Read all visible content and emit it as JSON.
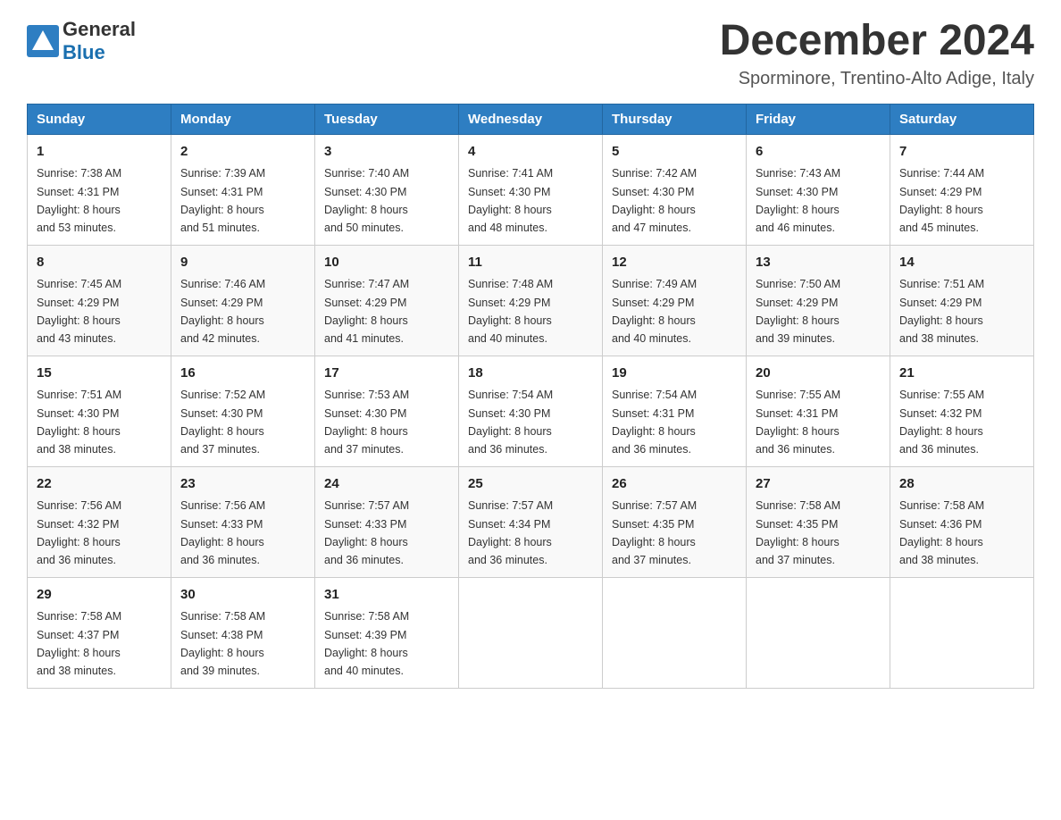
{
  "header": {
    "logo_general": "General",
    "logo_blue": "Blue",
    "month_title": "December 2024",
    "subtitle": "Sporminore, Trentino-Alto Adige, Italy"
  },
  "days_of_week": [
    "Sunday",
    "Monday",
    "Tuesday",
    "Wednesday",
    "Thursday",
    "Friday",
    "Saturday"
  ],
  "weeks": [
    [
      {
        "day": "1",
        "sunrise": "7:38 AM",
        "sunset": "4:31 PM",
        "daylight": "8 hours and 53 minutes."
      },
      {
        "day": "2",
        "sunrise": "7:39 AM",
        "sunset": "4:31 PM",
        "daylight": "8 hours and 51 minutes."
      },
      {
        "day": "3",
        "sunrise": "7:40 AM",
        "sunset": "4:30 PM",
        "daylight": "8 hours and 50 minutes."
      },
      {
        "day": "4",
        "sunrise": "7:41 AM",
        "sunset": "4:30 PM",
        "daylight": "8 hours and 48 minutes."
      },
      {
        "day": "5",
        "sunrise": "7:42 AM",
        "sunset": "4:30 PM",
        "daylight": "8 hours and 47 minutes."
      },
      {
        "day": "6",
        "sunrise": "7:43 AM",
        "sunset": "4:30 PM",
        "daylight": "8 hours and 46 minutes."
      },
      {
        "day": "7",
        "sunrise": "7:44 AM",
        "sunset": "4:29 PM",
        "daylight": "8 hours and 45 minutes."
      }
    ],
    [
      {
        "day": "8",
        "sunrise": "7:45 AM",
        "sunset": "4:29 PM",
        "daylight": "8 hours and 43 minutes."
      },
      {
        "day": "9",
        "sunrise": "7:46 AM",
        "sunset": "4:29 PM",
        "daylight": "8 hours and 42 minutes."
      },
      {
        "day": "10",
        "sunrise": "7:47 AM",
        "sunset": "4:29 PM",
        "daylight": "8 hours and 41 minutes."
      },
      {
        "day": "11",
        "sunrise": "7:48 AM",
        "sunset": "4:29 PM",
        "daylight": "8 hours and 40 minutes."
      },
      {
        "day": "12",
        "sunrise": "7:49 AM",
        "sunset": "4:29 PM",
        "daylight": "8 hours and 40 minutes."
      },
      {
        "day": "13",
        "sunrise": "7:50 AM",
        "sunset": "4:29 PM",
        "daylight": "8 hours and 39 minutes."
      },
      {
        "day": "14",
        "sunrise": "7:51 AM",
        "sunset": "4:29 PM",
        "daylight": "8 hours and 38 minutes."
      }
    ],
    [
      {
        "day": "15",
        "sunrise": "7:51 AM",
        "sunset": "4:30 PM",
        "daylight": "8 hours and 38 minutes."
      },
      {
        "day": "16",
        "sunrise": "7:52 AM",
        "sunset": "4:30 PM",
        "daylight": "8 hours and 37 minutes."
      },
      {
        "day": "17",
        "sunrise": "7:53 AM",
        "sunset": "4:30 PM",
        "daylight": "8 hours and 37 minutes."
      },
      {
        "day": "18",
        "sunrise": "7:54 AM",
        "sunset": "4:30 PM",
        "daylight": "8 hours and 36 minutes."
      },
      {
        "day": "19",
        "sunrise": "7:54 AM",
        "sunset": "4:31 PM",
        "daylight": "8 hours and 36 minutes."
      },
      {
        "day": "20",
        "sunrise": "7:55 AM",
        "sunset": "4:31 PM",
        "daylight": "8 hours and 36 minutes."
      },
      {
        "day": "21",
        "sunrise": "7:55 AM",
        "sunset": "4:32 PM",
        "daylight": "8 hours and 36 minutes."
      }
    ],
    [
      {
        "day": "22",
        "sunrise": "7:56 AM",
        "sunset": "4:32 PM",
        "daylight": "8 hours and 36 minutes."
      },
      {
        "day": "23",
        "sunrise": "7:56 AM",
        "sunset": "4:33 PM",
        "daylight": "8 hours and 36 minutes."
      },
      {
        "day": "24",
        "sunrise": "7:57 AM",
        "sunset": "4:33 PM",
        "daylight": "8 hours and 36 minutes."
      },
      {
        "day": "25",
        "sunrise": "7:57 AM",
        "sunset": "4:34 PM",
        "daylight": "8 hours and 36 minutes."
      },
      {
        "day": "26",
        "sunrise": "7:57 AM",
        "sunset": "4:35 PM",
        "daylight": "8 hours and 37 minutes."
      },
      {
        "day": "27",
        "sunrise": "7:58 AM",
        "sunset": "4:35 PM",
        "daylight": "8 hours and 37 minutes."
      },
      {
        "day": "28",
        "sunrise": "7:58 AM",
        "sunset": "4:36 PM",
        "daylight": "8 hours and 38 minutes."
      }
    ],
    [
      {
        "day": "29",
        "sunrise": "7:58 AM",
        "sunset": "4:37 PM",
        "daylight": "8 hours and 38 minutes."
      },
      {
        "day": "30",
        "sunrise": "7:58 AM",
        "sunset": "4:38 PM",
        "daylight": "8 hours and 39 minutes."
      },
      {
        "day": "31",
        "sunrise": "7:58 AM",
        "sunset": "4:39 PM",
        "daylight": "8 hours and 40 minutes."
      },
      null,
      null,
      null,
      null
    ]
  ],
  "labels": {
    "sunrise": "Sunrise:",
    "sunset": "Sunset:",
    "daylight": "Daylight:"
  }
}
